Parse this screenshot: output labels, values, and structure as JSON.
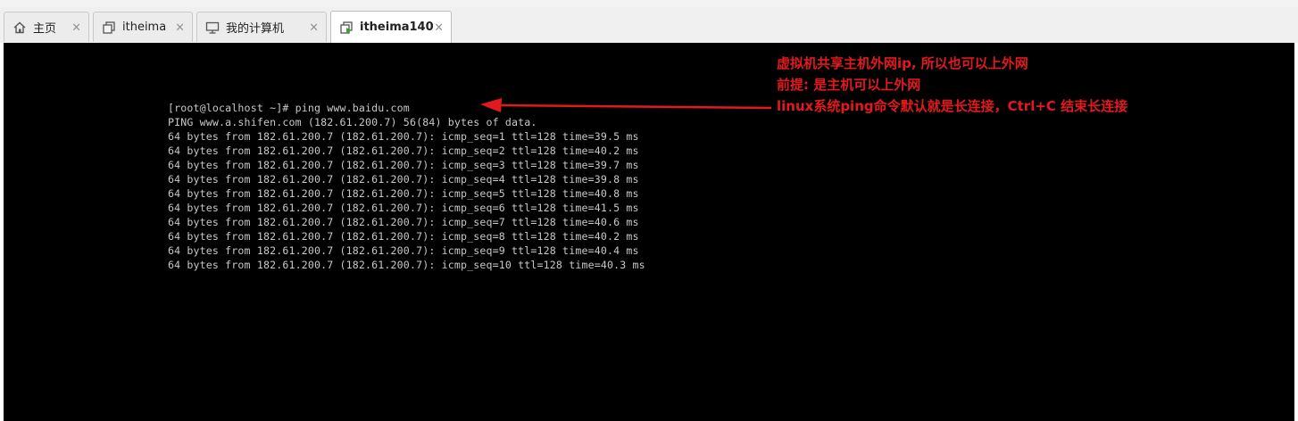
{
  "tabs": [
    {
      "label": "主页",
      "icon": "home-icon"
    },
    {
      "label": "itheima",
      "icon": "vm-clone-icon"
    },
    {
      "label": "我的计算机",
      "icon": "monitor-icon"
    },
    {
      "label": "itheima140",
      "icon": "vm-running-icon",
      "active": true
    }
  ],
  "tab_close_glyph": "×",
  "terminal": {
    "lines": [
      "[root@localhost ~]# ping www.baidu.com",
      "PING www.a.shifen.com (182.61.200.7) 56(84) bytes of data.",
      "64 bytes from 182.61.200.7 (182.61.200.7): icmp_seq=1 ttl=128 time=39.5 ms",
      "64 bytes from 182.61.200.7 (182.61.200.7): icmp_seq=2 ttl=128 time=40.2 ms",
      "64 bytes from 182.61.200.7 (182.61.200.7): icmp_seq=3 ttl=128 time=39.7 ms",
      "64 bytes from 182.61.200.7 (182.61.200.7): icmp_seq=4 ttl=128 time=39.8 ms",
      "64 bytes from 182.61.200.7 (182.61.200.7): icmp_seq=5 ttl=128 time=40.8 ms",
      "64 bytes from 182.61.200.7 (182.61.200.7): icmp_seq=6 ttl=128 time=41.5 ms",
      "64 bytes from 182.61.200.7 (182.61.200.7): icmp_seq=7 ttl=128 time=40.6 ms",
      "64 bytes from 182.61.200.7 (182.61.200.7): icmp_seq=8 ttl=128 time=40.2 ms",
      "64 bytes from 182.61.200.7 (182.61.200.7): icmp_seq=9 ttl=128 time=40.4 ms",
      "64 bytes from 182.61.200.7 (182.61.200.7): icmp_seq=10 ttl=128 time=40.3 ms"
    ]
  },
  "annotation": {
    "lines": [
      "虚拟机共享主机外网ip, 所以也可以上外网",
      "前提: 是主机可以上外网",
      "linux系统ping命令默认就是长连接，Ctrl+C 结束长连接"
    ],
    "color": "#e3191e"
  },
  "colors": {
    "console_bg": "#000000",
    "console_text": "#c8c8c8",
    "tab_bar_bg": "#f0f0f0",
    "active_tab_bg": "#ffffff"
  }
}
